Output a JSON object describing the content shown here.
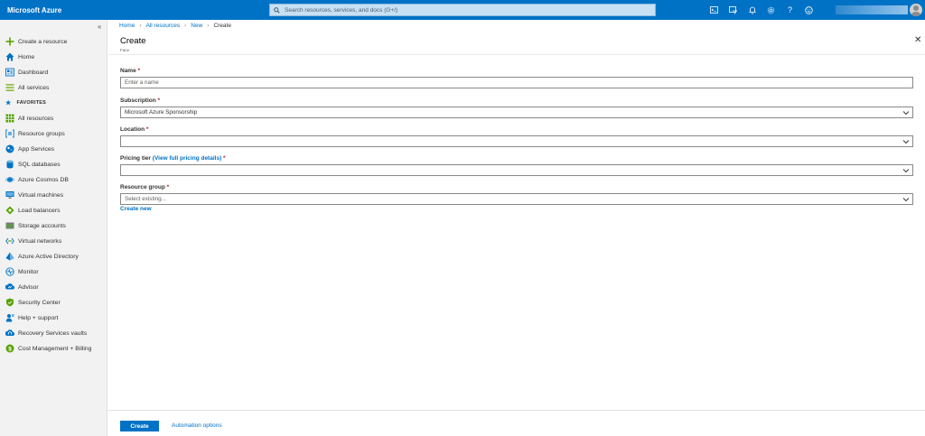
{
  "topbar": {
    "brand": "Microsoft Azure",
    "search_placeholder": "Search resources, services, and docs (G+/)",
    "icons": [
      "cloud-shell-icon",
      "directory-filter-icon",
      "notifications-icon",
      "settings-icon",
      "help-icon",
      "feedback-icon"
    ]
  },
  "sidebar": {
    "collapse": "«",
    "top_items": [
      {
        "label": "Create a resource",
        "icon": "plus-icon"
      },
      {
        "label": "Home",
        "icon": "home-icon"
      },
      {
        "label": "Dashboard",
        "icon": "dashboard-icon"
      },
      {
        "label": "All services",
        "icon": "all-services-icon"
      }
    ],
    "favorites_label": "FAVORITES",
    "favorites": [
      {
        "label": "All resources",
        "icon": "all-resources-icon"
      },
      {
        "label": "Resource groups",
        "icon": "resource-groups-icon"
      },
      {
        "label": "App Services",
        "icon": "app-services-icon"
      },
      {
        "label": "SQL databases",
        "icon": "sql-databases-icon"
      },
      {
        "label": "Azure Cosmos DB",
        "icon": "cosmos-db-icon"
      },
      {
        "label": "Virtual machines",
        "icon": "virtual-machines-icon"
      },
      {
        "label": "Load balancers",
        "icon": "load-balancers-icon"
      },
      {
        "label": "Storage accounts",
        "icon": "storage-accounts-icon"
      },
      {
        "label": "Virtual networks",
        "icon": "virtual-networks-icon"
      },
      {
        "label": "Azure Active Directory",
        "icon": "active-directory-icon"
      },
      {
        "label": "Monitor",
        "icon": "monitor-icon"
      },
      {
        "label": "Advisor",
        "icon": "advisor-icon"
      },
      {
        "label": "Security Center",
        "icon": "security-center-icon"
      },
      {
        "label": "Help + support",
        "icon": "help-support-icon"
      },
      {
        "label": "Recovery Services vaults",
        "icon": "recovery-vaults-icon"
      },
      {
        "label": "Cost Management + Billing",
        "icon": "cost-management-icon"
      }
    ]
  },
  "breadcrumb": [
    "Home",
    "All resources",
    "New",
    "Create"
  ],
  "blade": {
    "title": "Create",
    "subtitle": "Face",
    "close": "✕"
  },
  "form": {
    "name_label": "Name",
    "name_placeholder": "Enter a name",
    "subscription_label": "Subscription",
    "subscription_value": "Microsoft Azure Sponsorship",
    "location_label": "Location",
    "location_value": "",
    "pricing_label": "Pricing tier",
    "pricing_link": "(View full pricing details)",
    "pricing_value": "",
    "resource_group_label": "Resource group",
    "resource_group_placeholder": "Select existing...",
    "create_new": "Create new",
    "required_mark": "*"
  },
  "footer": {
    "create_button": "Create",
    "automation_link": "Automation options"
  },
  "colors": {
    "topbar": "#0072c6",
    "link": "#0072c6",
    "required": "#a4262c"
  }
}
